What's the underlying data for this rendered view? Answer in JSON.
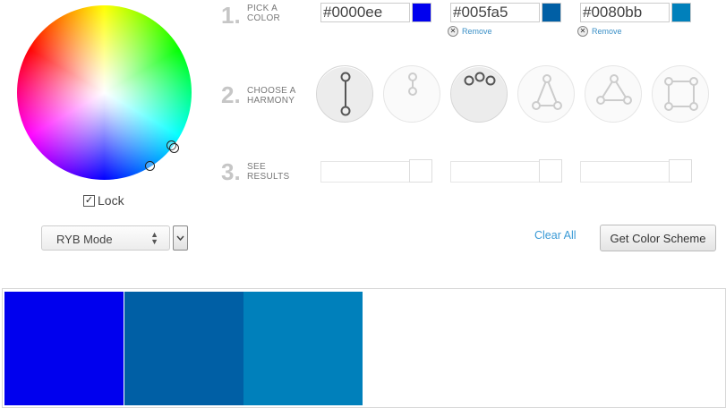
{
  "wheel": {
    "lock_label": "Lock",
    "lock_checked": true
  },
  "mode_select": {
    "value": "RYB Mode"
  },
  "steps": [
    {
      "number": "1.",
      "line1": "PICK A",
      "line2": "COLOR"
    },
    {
      "number": "2.",
      "line1": "CHOOSE A",
      "line2": "HARMONY"
    },
    {
      "number": "3.",
      "line1": "SEE",
      "line2": "RESULTS"
    }
  ],
  "colors": [
    {
      "hex": "#0000ee",
      "swatch": "#0000ee",
      "remove_label": ""
    },
    {
      "hex": "#005fa5",
      "swatch": "#005fa5",
      "remove_label": "Remove"
    },
    {
      "hex": "#0080bb",
      "swatch": "#0080bb",
      "remove_label": "Remove"
    }
  ],
  "harmonies": [
    {
      "icon": "complementary-icon",
      "selected": true
    },
    {
      "icon": "monochromatic-icon",
      "selected": false
    },
    {
      "icon": "analogous-icon",
      "selected": true
    },
    {
      "icon": "split-complementary-icon",
      "selected": false
    },
    {
      "icon": "triadic-icon",
      "selected": false
    },
    {
      "icon": "tetradic-icon",
      "selected": false
    }
  ],
  "actions": {
    "clear_all": "Clear All",
    "get_scheme": "Get Color Scheme"
  },
  "palette": [
    "#0000ee",
    "#005fa5",
    "#0080bb"
  ]
}
